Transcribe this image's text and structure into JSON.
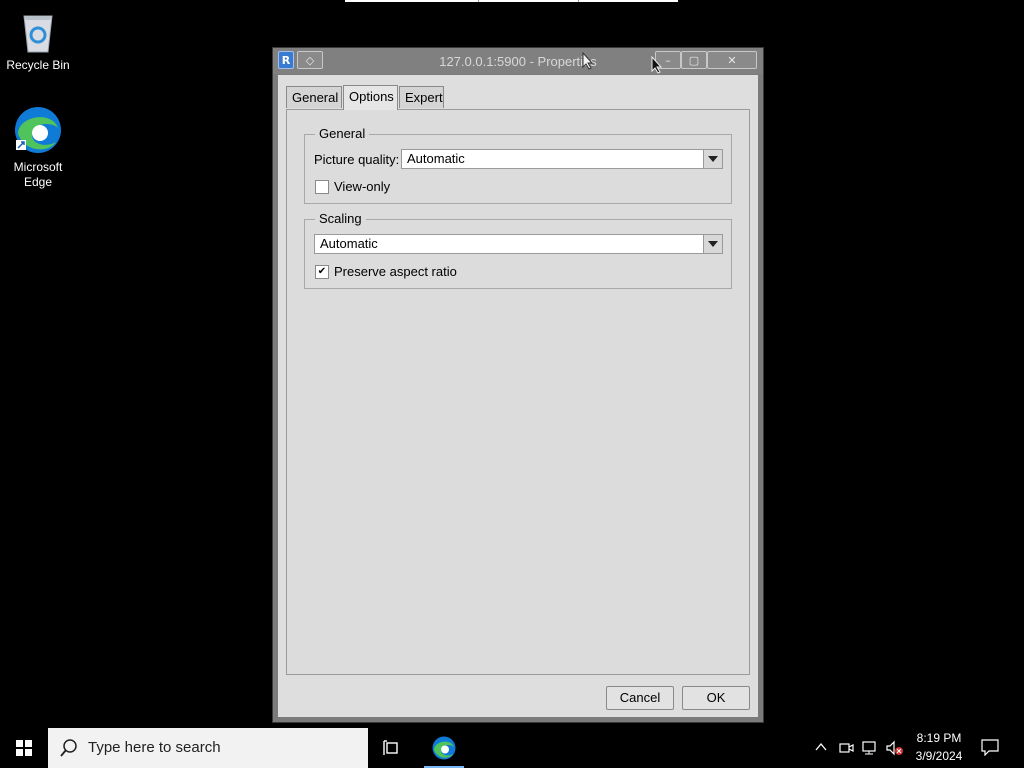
{
  "desktop": {
    "icons": [
      {
        "label": "Recycle Bin",
        "icon": "recycle-bin-icon"
      },
      {
        "label": "Microsoft Edge",
        "icon": "edge-icon"
      }
    ]
  },
  "window": {
    "title": "127.0.0.1:5900 - Properties",
    "tabs": [
      {
        "label": "General",
        "active": false
      },
      {
        "label": "Options",
        "active": true
      },
      {
        "label": "Expert",
        "active": false
      }
    ],
    "general_group": {
      "legend": "General",
      "picture_quality_label": "Picture quality:",
      "picture_quality_value": "Automatic",
      "view_only_label": "View-only",
      "view_only_checked": false
    },
    "scaling_group": {
      "legend": "Scaling",
      "scaling_value": "Automatic",
      "preserve_label": "Preserve aspect ratio",
      "preserve_checked": true
    },
    "buttons": {
      "cancel": "Cancel",
      "ok": "OK"
    }
  },
  "taskbar": {
    "search_placeholder": "Type here to search",
    "time": "8:19 PM",
    "date": "3/9/2024"
  },
  "colors": {
    "desktop_bg": "#000000",
    "dialog_bg": "#dedede",
    "edge_blue": "#0f7bd6",
    "edge_green": "#4fc35c"
  }
}
